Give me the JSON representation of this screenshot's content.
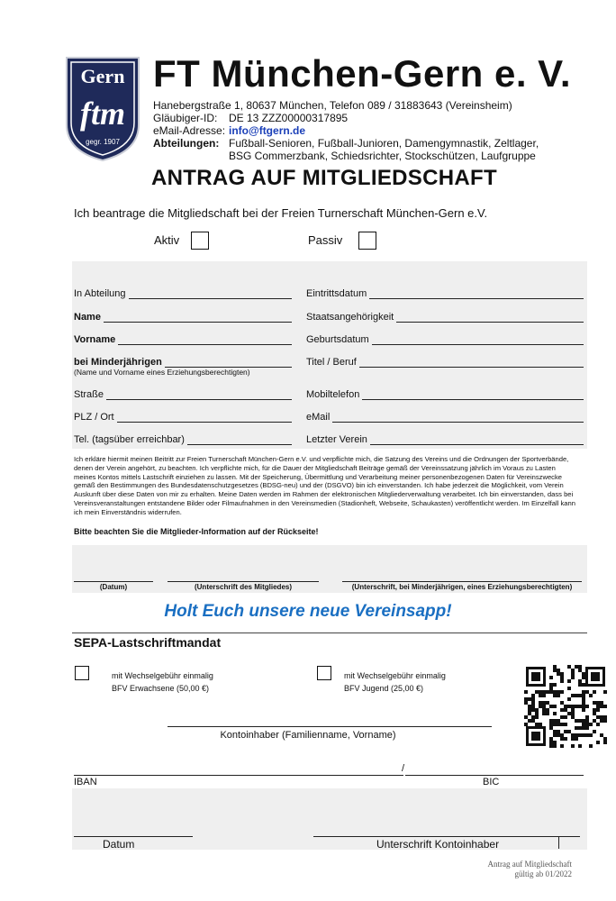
{
  "header": {
    "title": "FT München-Gern e. V.",
    "logo_text_top": "Gern",
    "logo_text_mid": "ftm",
    "logo_text_year": "gegr. 1907",
    "address": "Hanebergstraße 1, 80637 München, Telefon 089 / 31883643 (Vereinsheim)",
    "creditor_label": "Gläubiger-ID:",
    "creditor_value": "DE 13 ZZZ00000317895",
    "email_label": "eMail-Adresse:",
    "email_value": "info@ftgern.de",
    "departments_label": "Abteilungen:",
    "departments_line1": "Fußball-Senioren, Fußball-Junioren, Damengymnastik, Zeltlager,",
    "departments_line2": "BSG Commerzbank, Schiedsrichter, Stockschützen, Laufgruppe"
  },
  "form": {
    "heading": "ANTRAG AUF MITGLIEDSCHAFT",
    "intro": "Ich beantrage die Mitgliedschaft bei der Freien Turnerschaft München-Gern e.V.",
    "aktiv": "Aktiv",
    "passiv": "Passiv",
    "fields_left": {
      "abteilung": "In Abteilung",
      "name": "Name",
      "vorname": "Vorname",
      "minderjaehrig": "bei Minderjährigen",
      "minderjaehrig_note": "(Name und Vorname eines Erziehungsberechtigten)",
      "strasse": "Straße",
      "plz": "PLZ / Ort",
      "tel": "Tel. (tagsüber erreichbar)"
    },
    "fields_right": {
      "eintritt": "Eintrittsdatum",
      "staat": "Staatsangehörigkeit",
      "geburt": "Geburtsdatum",
      "titel": "Titel / Beruf",
      "mobil": "Mobiltelefon",
      "email": "eMail",
      "verein": "Letzter Verein"
    },
    "declaration": "Ich erkläre hiermit meinen Beitritt zur Freien Turnerschaft München-Gern e.V. und verpflichte mich, die Satzung des Vereins und die Ordnungen der Sportverbände, denen der Verein angehört, zu beachten. Ich verpflichte mich, für die Dauer der Mitgliedschaft Beiträge gemäß der Vereinssatzung jährlich im Voraus zu Lasten meines Kontos mittels Lastschrift einziehen zu lassen. Mit der Speicherung, Übermittlung und Verarbeitung meiner personenbezogenen Daten für Vereinszwecke gemäß den Bestimmungen des Bundesdatenschutzgesetzes (BDSG-neu) und der (DSGVO) bin ich einverstanden. Ich habe jederzeit die Möglichkeit, vom Verein Auskunft über diese Daten von mir zu erhalten. Meine Daten werden im Rahmen der elektronischen Mitgliederverwaltung verarbeitet. Ich bin einverstanden, dass bei Vereinsveranstaltungen entstandene Bilder oder Filmaufnahmen in den Vereinsmedien (Stadionheft, Webseite, Schaukasten) veröffentlicht werden. Im Einzelfall kann ich mein Einverständnis widerrufen.",
    "hint": "Bitte beachten Sie die Mitglieder-Information auf der Rückseite!",
    "sig_datum": "(Datum)",
    "sig_mitglied": "(Unterschrift des Mitgliedes)",
    "sig_erzieher": "(Unterschrift, bei Minderjährigen, eines Erziehungsberechtigten)"
  },
  "app_banner": "Holt Euch unsere neue Vereinsapp!",
  "sepa": {
    "heading": "SEPA-Lastschriftmandat",
    "opt1_line1": "mit Wechselgebühr einmalig",
    "opt1_line2": "BFV Erwachsene (50,00 €)",
    "opt2_line1": "mit Wechselgebühr einmalig",
    "opt2_line2": "BFV Jugend (25,00 €)",
    "kontoinhaber": "Kontoinhaber (Familienname, Vorname)",
    "iban": "IBAN",
    "separator": "/",
    "bic": "BIC",
    "datum": "Datum",
    "unterschrift": "Unterschrift Kontoinhaber"
  },
  "footer": {
    "line1": "Antrag auf Mitgliedschaft",
    "line2": "gültig ab 01/2022"
  },
  "colors": {
    "app_blue": "#1a6fc2",
    "email_blue": "#1a3fb8",
    "logo_navy": "#1f2a5a",
    "field_gray": "#efefef"
  }
}
